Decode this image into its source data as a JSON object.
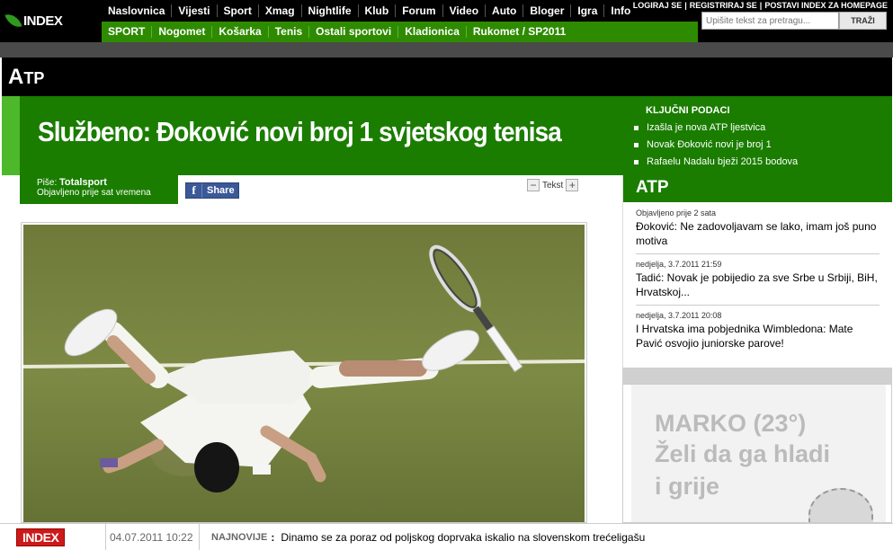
{
  "brand": {
    "logo": "INDEX"
  },
  "topnav": [
    "Naslovnica",
    "Vijesti",
    "Sport",
    "Xmag",
    "Nightlife",
    "Klub",
    "Forum",
    "Video",
    "Auto",
    "Bloger",
    "Igra",
    "Info"
  ],
  "subnav": [
    "SPORT",
    "Nogomet",
    "Košarka",
    "Tenis",
    "Ostali sportovi",
    "Kladionica",
    "Rukomet / SP2011"
  ],
  "userlinks": [
    "LOGIRAJ SE",
    "|",
    "REGISTRIRAJ SE",
    "|",
    "POSTAVI INDEX ZA HOMEPAGE"
  ],
  "search": {
    "placeholder": "Upišite tekst za pretragu...",
    "button": "TRAŽI"
  },
  "section": {
    "title_big": "A",
    "title_small": "TP"
  },
  "article": {
    "headline": "Službeno: Đoković novi broj 1 svjetskog tenisa",
    "byline_prefix": "Piše:",
    "author": "Totalsport",
    "published": "Objavljeno prije sat vremena",
    "share_label": "Share",
    "text_size_label": "Tekst",
    "minus": "−",
    "plus": "+"
  },
  "key_facts": {
    "title": "KLJUČNI PODACI",
    "items": [
      "Izašla je nova ATP ljestvica",
      "Novak Đoković novi je broj 1",
      "Rafaelu Nadalu bježi 2015 bodova"
    ]
  },
  "atp_box": {
    "title": "ATP",
    "news": [
      {
        "date": "Objavljeno prije 2 sata",
        "text": "Đoković: Ne zadovoljavam se lako, imam još puno motiva"
      },
      {
        "date": "nedjelja, 3.7.2011 21:59",
        "text": "Tadić: Novak je pobijedio za sve Srbe u Srbiji, BiH, Hrvatskoj..."
      },
      {
        "date": "nedjelja, 3.7.2011 20:08",
        "text": "I Hrvatska ima pobjednika Wimbledona: Mate Pavić osvojio juniorske parove!"
      }
    ]
  },
  "ad": {
    "line1": "MARKO (23°)",
    "line2": "Želi da ga hladi",
    "line3": "i grije"
  },
  "footer": {
    "logo": "INDEX",
    "timestamp": "04.07.2011 10:22",
    "label": "NAJNOVIJE",
    "separator": ":",
    "headline": "Dinamo se za poraz od poljskog doprvaka iskalio na slovenskom trećeligašu"
  },
  "colors": {
    "green": "#1a7d00",
    "light_green": "#4db82a",
    "black": "#000000"
  }
}
